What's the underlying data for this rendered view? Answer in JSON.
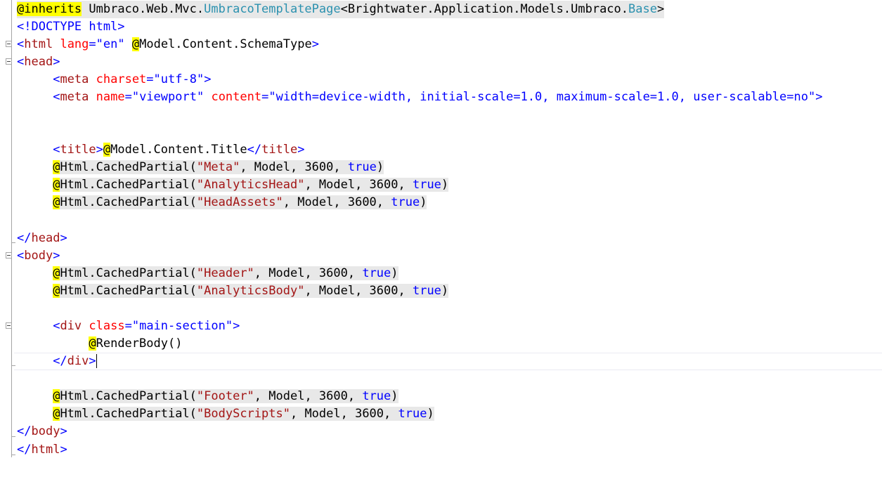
{
  "code": {
    "inherits_kw": "@inherits",
    "inherits_ns": "Umbraco.Web.Mvc.",
    "inherits_type": "UmbracoTemplatePage",
    "inherits_generic_open": "<Brightwater.Application.Models.Umbraco.",
    "inherits_base": "Base",
    "inherits_generic_close": ">",
    "doctype": "<!DOCTYPE html>",
    "html_open_tag": "html",
    "html_lang_attr": "lang",
    "html_lang_val": "\"en\"",
    "html_schema_at": "@",
    "html_schema_expr": "Model.Content.SchemaType",
    "head_tag": "head",
    "meta_charset_attr": "charset",
    "meta_charset_val": "\"utf-8\"",
    "meta_name_attr": "name",
    "meta_name_val": "\"viewport\"",
    "meta_content_attr": "content",
    "meta_content_val": "\"width=device-width, initial-scale=1.0, maximum-scale=1.0, user-scalable=no\"",
    "title_tag": "title",
    "title_at": "@",
    "title_expr": "Model.Content.Title",
    "partial_method": "Html.CachedPartial(",
    "partial_args": ", Model, 3600, ",
    "partial_true": "true",
    "partial_meta": "\"Meta\"",
    "partial_analytics_head": "\"AnalyticsHead\"",
    "partial_head_assets": "\"HeadAssets\"",
    "body_tag": "body",
    "partial_header": "\"Header\"",
    "partial_analytics_body": "\"AnalyticsBody\"",
    "div_tag": "div",
    "div_class_attr": "class",
    "div_class_val": "\"main-section\"",
    "render_body": "RenderBody()",
    "partial_footer": "\"Footer\"",
    "partial_body_scripts": "\"BodyScripts\""
  }
}
